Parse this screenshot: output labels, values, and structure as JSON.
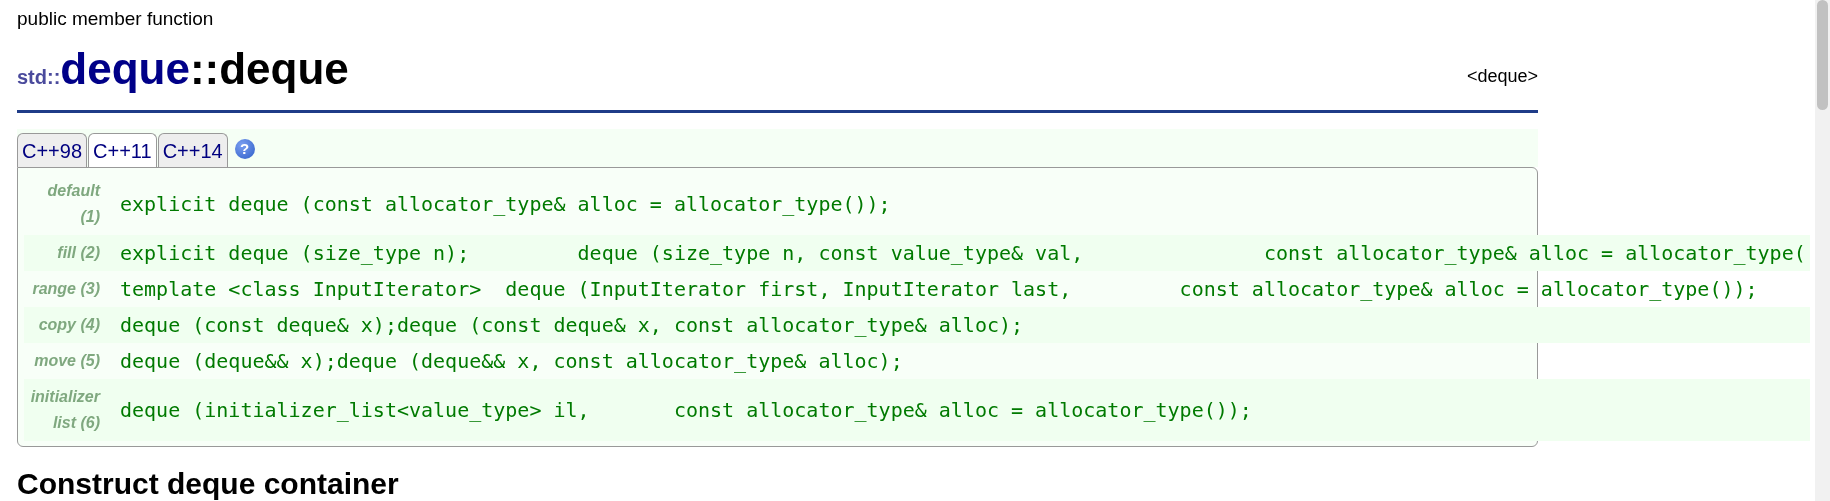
{
  "page_kind": "public member function",
  "title": {
    "namespace": "std::",
    "class_name": "deque",
    "member": "::deque"
  },
  "header": "<deque>",
  "tabs": [
    {
      "label": "C++98",
      "selected": false
    },
    {
      "label": "C++11",
      "selected": true
    },
    {
      "label": "C++14",
      "selected": false
    }
  ],
  "help_icon": "?",
  "prototypes": [
    {
      "label": "default (1)",
      "code": "explicit deque (const allocator_type& alloc = allocator_type());"
    },
    {
      "label": "fill (2)",
      "code": "explicit deque (size_type n);         deque (size_type n, const value_type& val,               const allocator_type& alloc = allocator_type("
    },
    {
      "label": "range (3)",
      "code": "template <class InputIterator>  deque (InputIterator first, InputIterator last,         const allocator_type& alloc = allocator_type());"
    },
    {
      "label": "copy (4)",
      "code": "deque (const deque& x);deque (const deque& x, const allocator_type& alloc);"
    },
    {
      "label": "move (5)",
      "code": "deque (deque&& x);deque (deque&& x, const allocator_type& alloc);"
    },
    {
      "label": "initializer list (6)",
      "code": "deque (initializer_list<value_type> il,       const allocator_type& alloc = allocator_type());"
    }
  ],
  "section_heading": "Construct deque container"
}
